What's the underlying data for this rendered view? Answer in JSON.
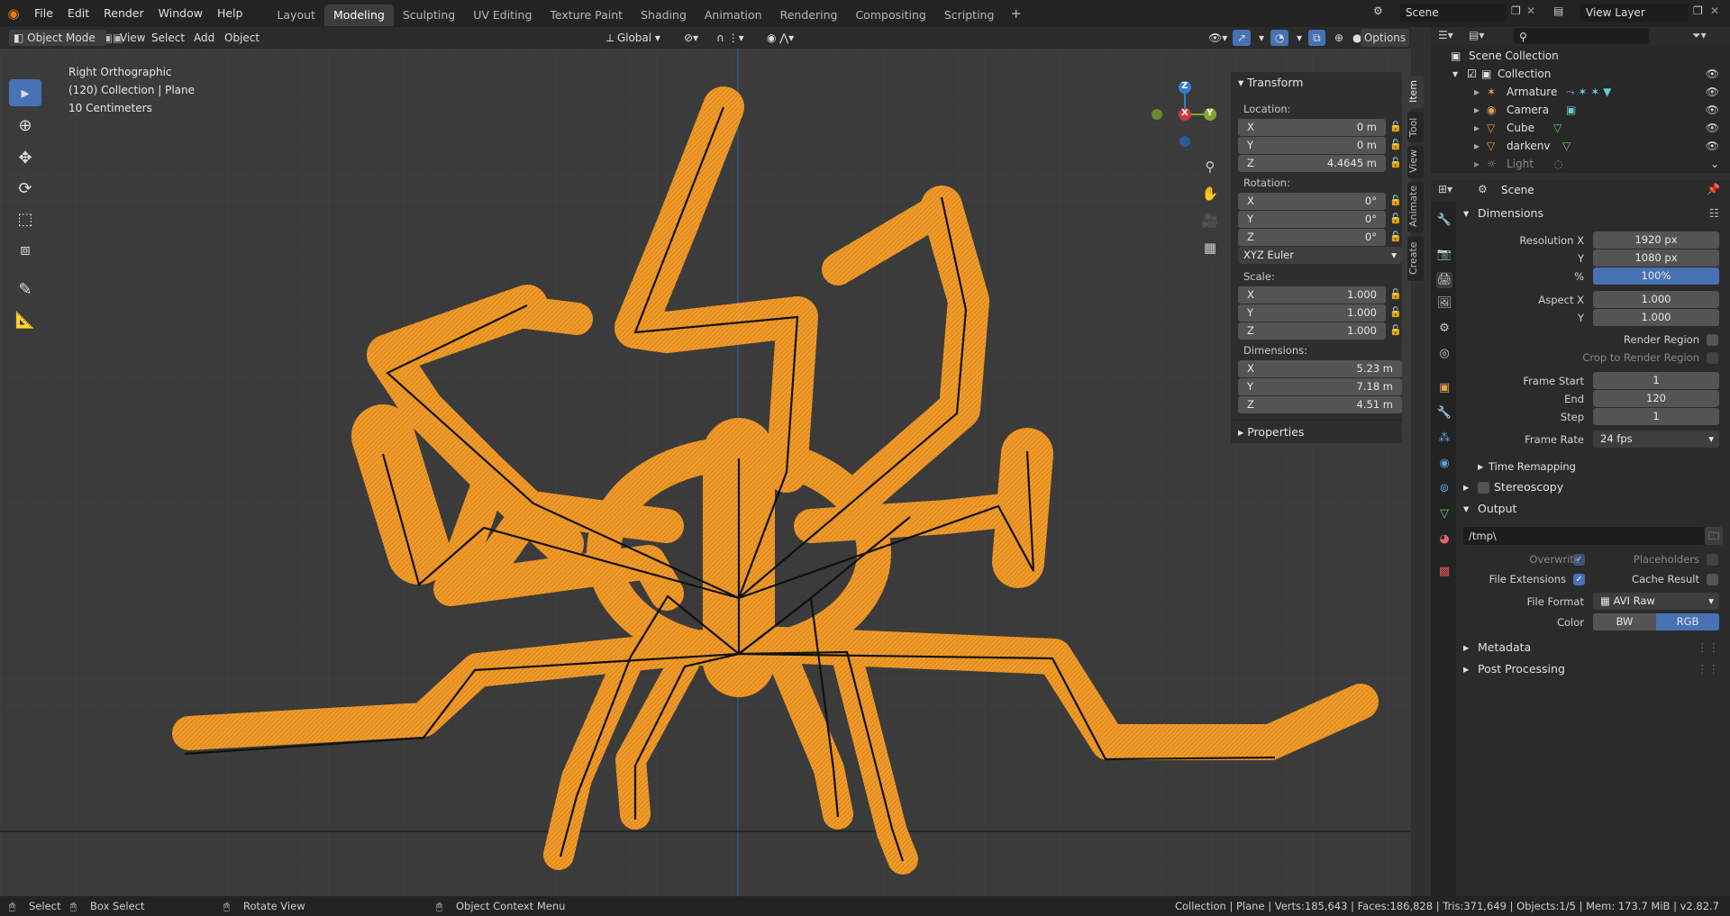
{
  "menus": [
    "File",
    "Edit",
    "Render",
    "Window",
    "Help"
  ],
  "workspaces": [
    "Layout",
    "Modeling",
    "Sculpting",
    "UV Editing",
    "Texture Paint",
    "Shading",
    "Animation",
    "Rendering",
    "Compositing",
    "Scripting"
  ],
  "active_workspace": "Modeling",
  "scene_name": "Scene",
  "view_layer": "View Layer",
  "header": {
    "mode": "Object Mode",
    "menu": [
      "View",
      "Select",
      "Add",
      "Object"
    ],
    "orientation": "Global",
    "options": "Options"
  },
  "viewport": {
    "view_name": "Right Orthographic",
    "collection_line": "(120) Collection | Plane",
    "scale": "10 Centimeters",
    "gizmo": {
      "z": "Z",
      "x": "X",
      "y": "Y"
    }
  },
  "npanel": {
    "title": "Transform",
    "location_label": "Location:",
    "location": [
      {
        "axis": "X",
        "value": "0 m"
      },
      {
        "axis": "Y",
        "value": "0 m"
      },
      {
        "axis": "Z",
        "value": "4.4645 m"
      }
    ],
    "rotation_label": "Rotation:",
    "rotation": [
      {
        "axis": "X",
        "value": "0°"
      },
      {
        "axis": "Y",
        "value": "0°"
      },
      {
        "axis": "Z",
        "value": "0°"
      }
    ],
    "rotation_mode": "XYZ Euler",
    "scale_label": "Scale:",
    "scale": [
      {
        "axis": "X",
        "value": "1.000"
      },
      {
        "axis": "Y",
        "value": "1.000"
      },
      {
        "axis": "Z",
        "value": "1.000"
      }
    ],
    "dimensions_label": "Dimensions:",
    "dimensions": [
      {
        "axis": "X",
        "value": "5.23 m"
      },
      {
        "axis": "Y",
        "value": "7.18 m"
      },
      {
        "axis": "Z",
        "value": "4.51 m"
      }
    ],
    "properties": "Properties",
    "tabs": [
      "Item",
      "Tool",
      "View",
      "Animate",
      "Create"
    ]
  },
  "outliner": {
    "root": "Scene Collection",
    "collection": "Collection",
    "items": [
      "Armature",
      "Camera",
      "Cube",
      "darkenv",
      "Light"
    ]
  },
  "properties": {
    "context": "Scene",
    "dimensions_title": "Dimensions",
    "resolution_x_label": "Resolution X",
    "resolution_x": "1920 px",
    "resolution_y_label": "Y",
    "resolution_y": "1080 px",
    "percent_label": "%",
    "percent": "100%",
    "percent_fill": 1.0,
    "aspect_x_label": "Aspect X",
    "aspect_x": "1.000",
    "aspect_y_label": "Y",
    "aspect_y": "1.000",
    "render_region": "Render Region",
    "crop_region": "Crop to Render Region",
    "frame_start_label": "Frame Start",
    "frame_start": "1",
    "end_label": "End",
    "end": "120",
    "step_label": "Step",
    "step": "1",
    "frame_rate_label": "Frame Rate",
    "frame_rate": "24 fps",
    "time_remapping": "Time Remapping",
    "stereoscopy": "Stereoscopy",
    "output_title": "Output",
    "output_path": "/tmp\\",
    "overwrite": "Overwrite",
    "placeholders": "Placeholders",
    "file_extensions": "File Extensions",
    "cache_result": "Cache Result",
    "file_format_label": "File Format",
    "file_format": "AVI Raw",
    "color_label": "Color",
    "color_bw": "BW",
    "color_rgb": "RGB",
    "metadata": "Metadata",
    "post_processing": "Post Processing"
  },
  "status": {
    "select": "Select",
    "box_select": "Box Select",
    "rotate_view": "Rotate View",
    "context_menu": "Object Context Menu",
    "stats": "Collection | Plane | Verts:185,643 | Faces:186,828 | Tris:371,649 | Objects:1/5 | Mem: 173.7 MiB | v2.82.7"
  },
  "colors": {
    "mesh": "#f09a2a",
    "accent": "#4772b3",
    "bg": "#3b3b3b"
  }
}
